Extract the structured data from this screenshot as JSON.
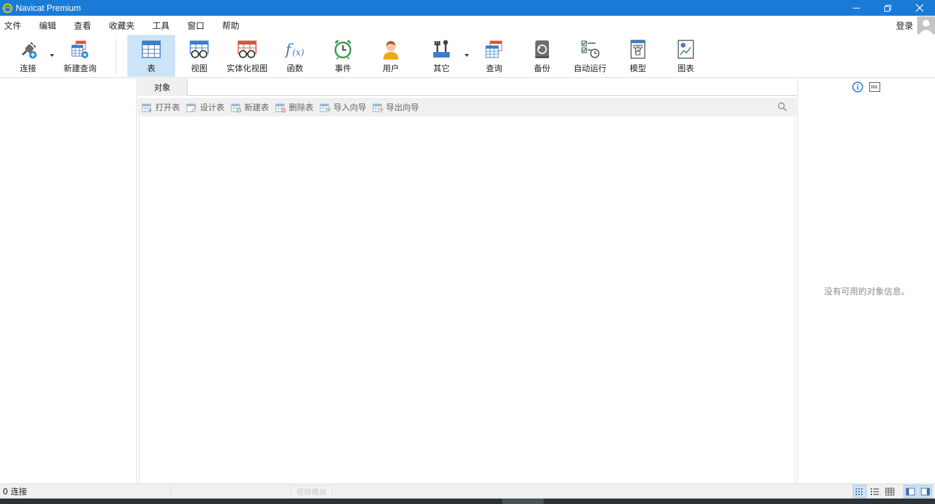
{
  "window": {
    "title": "Navicat Premium"
  },
  "menu": {
    "items": [
      "文件",
      "编辑",
      "查看",
      "收藏夹",
      "工具",
      "窗口",
      "帮助"
    ],
    "login_label": "登录"
  },
  "toolbar": {
    "connect": "连接",
    "new_query": "新建查询",
    "table": "表",
    "view": "视图",
    "mat_view": "实体化视图",
    "function": "函数",
    "event": "事件",
    "user": "用户",
    "other": "其它",
    "query": "查询",
    "backup": "备份",
    "auto_run": "自动运行",
    "model": "模型",
    "chart": "图表",
    "active": "table"
  },
  "tabs": {
    "objects": "对象"
  },
  "object_toolbar": {
    "open_table": "打开表",
    "design_table": "设计表",
    "new_table": "新建表",
    "delete_table": "删除表",
    "import_wizard": "导入向导",
    "export_wizard": "导出向导"
  },
  "info_pane": {
    "empty_text": "没有可用的对象信息。",
    "ddl_label": "DDL"
  },
  "status": {
    "connections": "0 连接",
    "watermark": "视频播放"
  },
  "colors": {
    "titlebar": "#1a7bd6",
    "active_tab": "#cde3f7",
    "table_icon_blue": "#3d7ec5",
    "table_icon_red": "#d4553c"
  }
}
